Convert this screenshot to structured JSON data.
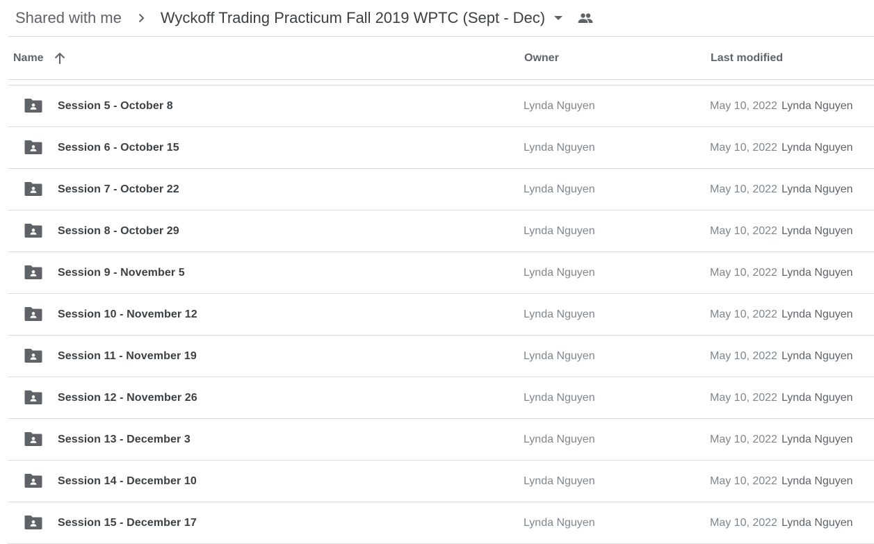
{
  "breadcrumb": {
    "root": "Shared with me",
    "current": "Wyckoff Trading Practicum Fall 2019 WPTC (Sept - Dec)"
  },
  "icons": {
    "separator": "chevron-right-icon",
    "dropdown": "caret-down-icon",
    "shared": "people-icon",
    "sort": "arrow-up-icon",
    "folder": "shared-folder-icon"
  },
  "columns": {
    "name": "Name",
    "owner": "Owner",
    "modified": "Last modified"
  },
  "colors": {
    "folder_icon": "#5f6368",
    "divider": "#dadce0",
    "primary_text": "#3c4043",
    "secondary_text": "#80868b"
  },
  "files": [
    {
      "name": "Session 5 - October 8",
      "owner": "Lynda Nguyen",
      "modified_date": "May 10, 2022",
      "modified_by": "Lynda Nguyen"
    },
    {
      "name": "Session 6 - October 15",
      "owner": "Lynda Nguyen",
      "modified_date": "May 10, 2022",
      "modified_by": "Lynda Nguyen"
    },
    {
      "name": "Session 7 - October 22",
      "owner": "Lynda Nguyen",
      "modified_date": "May 10, 2022",
      "modified_by": "Lynda Nguyen"
    },
    {
      "name": "Session 8 - October 29",
      "owner": "Lynda Nguyen",
      "modified_date": "May 10, 2022",
      "modified_by": "Lynda Nguyen"
    },
    {
      "name": "Session 9 - November 5",
      "owner": "Lynda Nguyen",
      "modified_date": "May 10, 2022",
      "modified_by": "Lynda Nguyen"
    },
    {
      "name": "Session 10 - November 12",
      "owner": "Lynda Nguyen",
      "modified_date": "May 10, 2022",
      "modified_by": "Lynda Nguyen"
    },
    {
      "name": "Session 11 - November 19",
      "owner": "Lynda Nguyen",
      "modified_date": "May 10, 2022",
      "modified_by": "Lynda Nguyen"
    },
    {
      "name": "Session 12 - November 26",
      "owner": "Lynda Nguyen",
      "modified_date": "May 10, 2022",
      "modified_by": "Lynda Nguyen"
    },
    {
      "name": "Session 13 - December 3",
      "owner": "Lynda Nguyen",
      "modified_date": "May 10, 2022",
      "modified_by": "Lynda Nguyen"
    },
    {
      "name": "Session 14 - December 10",
      "owner": "Lynda Nguyen",
      "modified_date": "May 10, 2022",
      "modified_by": "Lynda Nguyen"
    },
    {
      "name": "Session 15 - December 17",
      "owner": "Lynda Nguyen",
      "modified_date": "May 10, 2022",
      "modified_by": "Lynda Nguyen"
    }
  ]
}
